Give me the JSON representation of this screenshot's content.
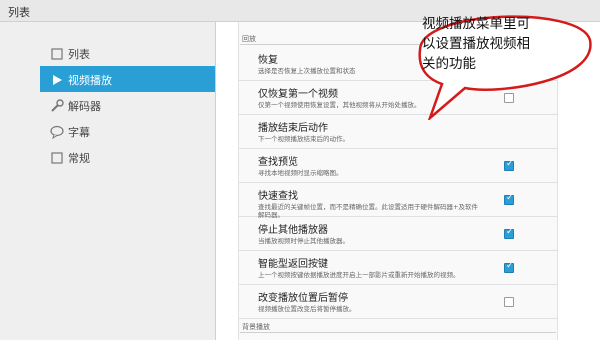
{
  "window": {
    "title": "列表"
  },
  "sidebar": {
    "items": [
      {
        "label": "列表",
        "icon": "square-icon",
        "active": false
      },
      {
        "label": "视频播放",
        "icon": "play-icon",
        "active": true
      },
      {
        "label": "解码器",
        "icon": "wrench-icon",
        "active": false
      },
      {
        "label": "字幕",
        "icon": "speech-bubble-icon",
        "active": false
      },
      {
        "label": "常规",
        "icon": "square-icon",
        "active": false
      }
    ]
  },
  "main": {
    "section_playback": "回放",
    "section_background": "背景播放",
    "rows": [
      {
        "title": "恢复",
        "desc": "选择是否恢复上次播放位置和状态",
        "desc2": "",
        "checkbox": false
      },
      {
        "title": "仅恢复第一个视频",
        "desc": "仅第一个视频使用恢复设置，其他视频将从开始处播放。",
        "desc2": "",
        "checkbox": true,
        "checked": false
      },
      {
        "title": "播放结束后动作",
        "desc": "下一个视频播放结束后的动作。",
        "desc2": "",
        "checkbox": false
      },
      {
        "title": "查找预览",
        "desc": "寻找本地视频时显示缩略图。",
        "desc2": "",
        "checkbox": true,
        "checked": true
      },
      {
        "title": "快速查找",
        "desc": "查找最近的关键帧位置，而不是精确位置。此设置适用于硬件解码器+及软件",
        "desc2": "解码器。",
        "checkbox": true,
        "checked": true
      },
      {
        "title": "停止其他播放器",
        "desc": "当播放视频时停止其他播放器。",
        "desc2": "",
        "checkbox": true,
        "checked": true
      },
      {
        "title": "智能型返回按键",
        "desc": "上一个视频按键依据播放进度开启上一部影片或重新开始播放的视频。",
        "desc2": "",
        "checkbox": true,
        "checked": true
      },
      {
        "title": "改变播放位置后暂停",
        "desc": "视频播放位置改变后将暂停播放。",
        "desc2": "",
        "checkbox": true,
        "checked": false
      }
    ]
  },
  "callout": {
    "lines": [
      "视频播放菜单里可",
      "以设置播放视频相",
      "关的功能"
    ],
    "fill": "#ffffff",
    "stroke": "#d41a1a"
  },
  "colors": {
    "accent": "#2a9fd6"
  }
}
